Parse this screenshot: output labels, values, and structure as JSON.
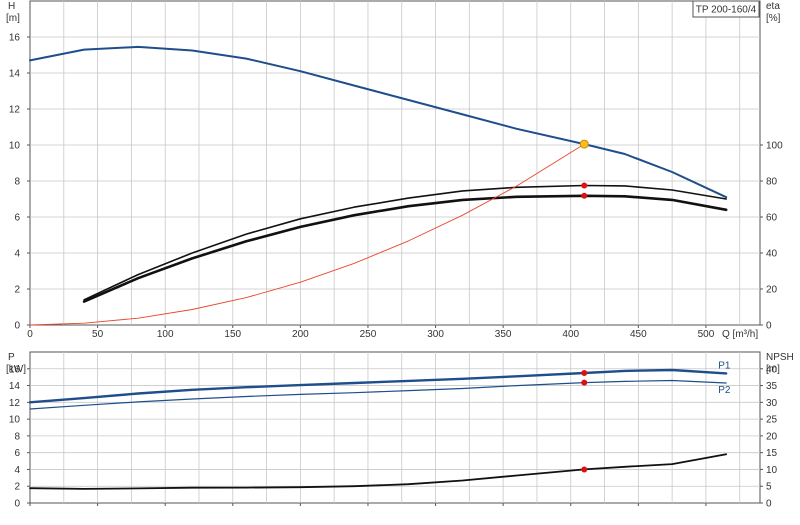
{
  "colors": {
    "grid": "#c8c8c8",
    "frame": "#555555",
    "head": "#1f4e8c",
    "black": "#111111",
    "system": "#e8482b",
    "point": "#e01010",
    "opPoint": "#f4c020"
  },
  "chart_data": [
    {
      "type": "line",
      "title": "TP 200-160/4",
      "xlabel": "Q [m³/h]",
      "ylabel": [
        "H",
        "[m]"
      ],
      "y2label": [
        "eta",
        "[%]"
      ],
      "xlim": [
        0,
        540
      ],
      "ylim": [
        0,
        18
      ],
      "y2lim": [
        0,
        180
      ],
      "xticks": [
        0,
        50,
        100,
        150,
        200,
        250,
        300,
        350,
        400,
        450,
        500
      ],
      "yticks": [
        0,
        2,
        4,
        6,
        8,
        10,
        12,
        14,
        16
      ],
      "y2ticks": [
        0,
        20,
        40,
        60,
        80,
        100
      ],
      "grid": true,
      "series": [
        {
          "axis": "left",
          "color": "head",
          "width": 2,
          "x": [
            0,
            40,
            80,
            120,
            160,
            200,
            240,
            280,
            320,
            360,
            410,
            440,
            475,
            515
          ],
          "y": [
            14.7,
            15.3,
            15.45,
            15.25,
            14.8,
            14.1,
            13.3,
            12.5,
            11.7,
            10.9,
            10.05,
            9.5,
            8.5,
            7.1
          ]
        },
        {
          "axis": "right",
          "color": "black",
          "width": 1.6,
          "x": [
            40,
            80,
            120,
            160,
            200,
            240,
            280,
            320,
            360,
            410,
            440,
            475,
            515
          ],
          "y": [
            14,
            28,
            40,
            50.5,
            59,
            65.5,
            70.5,
            74.5,
            76.5,
            77.5,
            77.3,
            75,
            70
          ]
        },
        {
          "axis": "right",
          "color": "black",
          "width": 2.6,
          "x": [
            40,
            80,
            120,
            160,
            200,
            240,
            280,
            320,
            360,
            410,
            440,
            475,
            515
          ],
          "y": [
            13,
            26,
            37,
            46.5,
            54.5,
            61,
            66,
            69.5,
            71.2,
            71.8,
            71.5,
            69.5,
            64
          ]
        },
        {
          "axis": "left",
          "color": "system",
          "width": 0.9,
          "x": [
            0,
            40,
            80,
            120,
            160,
            200,
            240,
            280,
            320,
            360,
            410
          ],
          "y": [
            0,
            0.1,
            0.38,
            0.86,
            1.52,
            2.38,
            3.43,
            4.67,
            6.1,
            7.72,
            10.05
          ]
        }
      ],
      "points": [
        {
          "axis": "left",
          "x": 410,
          "y": 10.05,
          "color": "opPoint"
        },
        {
          "axis": "right",
          "x": 410,
          "y": 77.5,
          "color": "point"
        },
        {
          "axis": "right",
          "x": 410,
          "y": 71.8,
          "color": "point"
        }
      ]
    },
    {
      "type": "line",
      "ylabel": [
        "P",
        "[kW]"
      ],
      "y2label": [
        "NPSH",
        "[m]"
      ],
      "xlim": [
        0,
        540
      ],
      "ylim": [
        0,
        18
      ],
      "y2lim": [
        0,
        45
      ],
      "yticks": [
        0,
        2,
        4,
        6,
        8,
        10,
        12,
        14,
        16
      ],
      "y2ticks": [
        0,
        5,
        10,
        15,
        20,
        25,
        30,
        35,
        40
      ],
      "grid": true,
      "series": [
        {
          "name": "P1",
          "axis": "left",
          "color": "head",
          "width": 2.4,
          "x": [
            0,
            40,
            80,
            120,
            160,
            200,
            240,
            280,
            320,
            360,
            410,
            440,
            475,
            515
          ],
          "y": [
            12.0,
            12.5,
            13.05,
            13.5,
            13.8,
            14.05,
            14.3,
            14.55,
            14.8,
            15.1,
            15.5,
            15.75,
            15.85,
            15.45
          ]
        },
        {
          "name": "P2",
          "axis": "left",
          "color": "head",
          "width": 1.2,
          "x": [
            0,
            40,
            80,
            120,
            160,
            200,
            240,
            280,
            320,
            360,
            410,
            440,
            475,
            515
          ],
          "y": [
            11.2,
            11.65,
            12.05,
            12.4,
            12.7,
            12.95,
            13.15,
            13.4,
            13.65,
            14.0,
            14.35,
            14.5,
            14.6,
            14.3
          ]
        },
        {
          "axis": "right",
          "color": "black",
          "width": 1.8,
          "x": [
            0,
            40,
            80,
            120,
            160,
            200,
            240,
            280,
            320,
            360,
            410,
            440,
            475,
            515
          ],
          "y": [
            4.4,
            4.2,
            4.35,
            4.55,
            4.6,
            4.7,
            5.0,
            5.6,
            6.7,
            8.2,
            10.0,
            10.8,
            11.6,
            14.5
          ]
        }
      ],
      "points": [
        {
          "axis": "left",
          "x": 410,
          "y": 15.5,
          "color": "point"
        },
        {
          "axis": "left",
          "x": 410,
          "y": 14.35,
          "color": "point"
        },
        {
          "axis": "right",
          "x": 410,
          "y": 10.0,
          "color": "point"
        }
      ]
    }
  ]
}
